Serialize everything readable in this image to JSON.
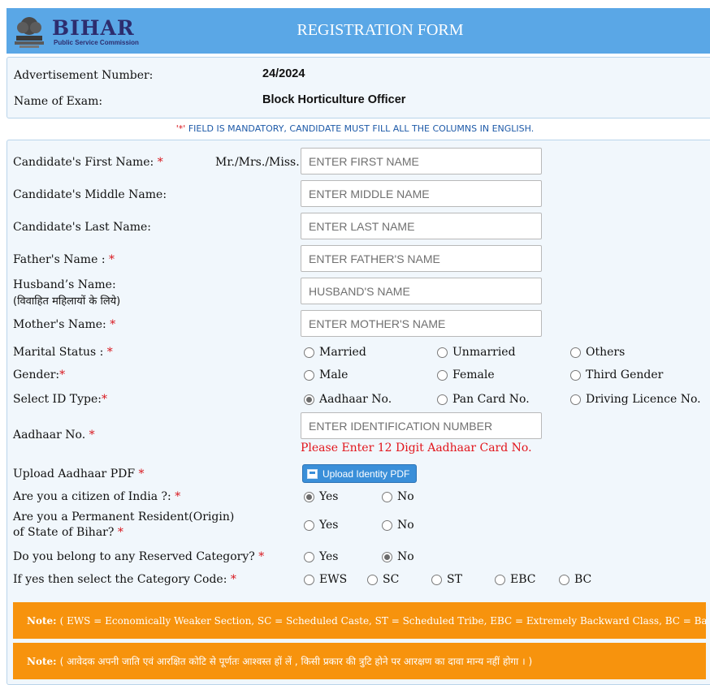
{
  "header": {
    "brand": "BIHAR",
    "brand_sub": "Public Service Commission",
    "title": "REGISTRATION FORM"
  },
  "advertisement": {
    "number_label": "Advertisement Number:",
    "number_value": "24/2024",
    "exam_label": "Name of Exam:",
    "exam_value": "Block Horticulture Officer"
  },
  "mandatory_star": "'*'",
  "mandatory_text": "FIELD IS MANDATORY, CANDIDATE MUST FILL ALL THE COLUMNS IN ENGLISH.",
  "form": {
    "first_name": {
      "label": "Candidate's First Name:",
      "prefix": "Mr./Mrs./Miss.",
      "placeholder": "ENTER FIRST NAME"
    },
    "middle_name": {
      "label": "Candidate's Middle Name:",
      "placeholder": "ENTER MIDDLE NAME"
    },
    "last_name": {
      "label": "Candidate's Last Name:",
      "placeholder": "ENTER LAST NAME"
    },
    "father_name": {
      "label": "Father's Name :",
      "placeholder": "ENTER FATHER'S NAME"
    },
    "husband_name": {
      "label": "Husband’s Name:",
      "label_hindi": "(विवाहित महिलायों के लिये)",
      "placeholder": "HUSBAND'S NAME"
    },
    "mother_name": {
      "label": "Mother's Name:",
      "placeholder": "ENTER MOTHER'S NAME"
    },
    "marital_status": {
      "label": "Marital Status :",
      "options": [
        "Married",
        "Unmarried",
        "Others"
      ]
    },
    "gender": {
      "label": "Gender:",
      "options": [
        "Male",
        "Female",
        "Third Gender"
      ]
    },
    "id_type": {
      "label": "Select ID Type:",
      "options": [
        "Aadhaar No.",
        "Pan Card No.",
        "Driving Licence No."
      ],
      "selected": "Aadhaar No."
    },
    "aadhaar_no": {
      "label": "Aadhaar No.",
      "placeholder": "ENTER IDENTIFICATION NUMBER",
      "hint": "Please Enter 12 Digit Aadhaar Card No."
    },
    "upload": {
      "label": "Upload Aadhaar PDF",
      "button": "Upload Identity PDF"
    },
    "citizen": {
      "label": "Are you a citizen of India ?:",
      "options": [
        "Yes",
        "No"
      ],
      "selected": "Yes"
    },
    "resident": {
      "label_line1": "Are you a Permanent Resident(Origin)",
      "label_line2": "of State of Bihar?",
      "options": [
        "Yes",
        "No"
      ]
    },
    "reserved": {
      "label": "Do you belong to any Reserved Category?",
      "options": [
        "Yes",
        "No"
      ],
      "selected": "No"
    },
    "category_code": {
      "label": "If yes then select the Category Code:",
      "options": [
        "EWS",
        "SC",
        "ST",
        "EBC",
        "BC"
      ]
    }
  },
  "notes": [
    {
      "prefix": "Note:",
      "text": "( EWS = Economically Weaker Section, SC = Scheduled Caste, ST = Scheduled Tribe, EBC = Extremely Backward Class, BC = Backward Class)"
    },
    {
      "prefix": "Note:",
      "text": "( आवेदक अपनी जाति एवं आरक्षित कोटि से पूर्णतः आश्वस्त हों लें , किसी प्रकार की त्रुटि होने पर आरक्षण का दावा मान्य नहीं होगा । )"
    }
  ],
  "required_mark": "*",
  "colors": {
    "header_bg": "#5aa7e6",
    "panel_bg": "#f1f7fc",
    "note_bg": "#f7930d",
    "required": "#d8141b",
    "button": "#3a8fd9"
  }
}
